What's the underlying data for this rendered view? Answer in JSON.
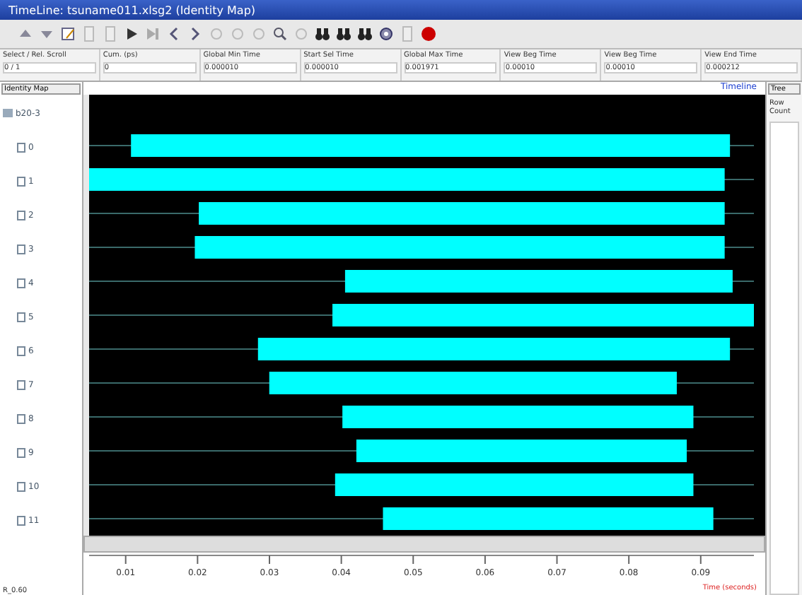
{
  "window": {
    "title": "TimeLine: tsuname011.xlsg2 (Identity Map)"
  },
  "toolbar": [
    {
      "kind": "up"
    },
    {
      "kind": "down"
    },
    {
      "kind": "edit"
    },
    {
      "kind": "doc"
    },
    {
      "kind": "doc"
    },
    {
      "kind": "play"
    },
    {
      "kind": "skip"
    },
    {
      "kind": "left"
    },
    {
      "kind": "right"
    },
    {
      "kind": "grey"
    },
    {
      "kind": "grey"
    },
    {
      "kind": "grey"
    },
    {
      "kind": "zoom"
    },
    {
      "kind": "grey"
    },
    {
      "kind": "binoculars"
    },
    {
      "kind": "binoculars"
    },
    {
      "kind": "binoculars"
    },
    {
      "kind": "target"
    },
    {
      "kind": "doc"
    },
    {
      "kind": "record"
    }
  ],
  "info": [
    {
      "label": "Select / Rel. Scroll",
      "value": "0 / 1"
    },
    {
      "label": "Cum. (ps)",
      "value": "0"
    },
    {
      "label": "Global Min Time",
      "value": "0.000010"
    },
    {
      "label": "Start Sel Time",
      "value": "0.000010"
    },
    {
      "label": "Global Max Time",
      "value": "0.001971"
    },
    {
      "label": "View Beg Time",
      "value": "0.00010"
    },
    {
      "label": "View Beg Time",
      "value": "0.00010"
    },
    {
      "label": "View End Time",
      "value": "0.000212"
    }
  ],
  "left_panel": {
    "dropdown": "Identity Map"
  },
  "tree": {
    "label": "b20-3",
    "expanded": true,
    "children": [
      {
        "label": "0"
      },
      {
        "label": "1"
      },
      {
        "label": "2"
      },
      {
        "label": "3"
      },
      {
        "label": "4"
      },
      {
        "label": "5"
      },
      {
        "label": "6"
      },
      {
        "label": "7"
      },
      {
        "label": "8"
      },
      {
        "label": "9"
      },
      {
        "label": "10"
      },
      {
        "label": "11"
      }
    ]
  },
  "timeline_label": "Timeline",
  "axis": {
    "ticks": [
      "0.01",
      "0.02",
      "0.03",
      "0.04",
      "0.05",
      "0.06",
      "0.07",
      "0.08",
      "0.09"
    ],
    "title": "Time (seconds)"
  },
  "bottom_left": {
    "label": "R_0.60"
  },
  "right_panel": {
    "dropdown": "Tree",
    "label": "Row Count"
  }
}
